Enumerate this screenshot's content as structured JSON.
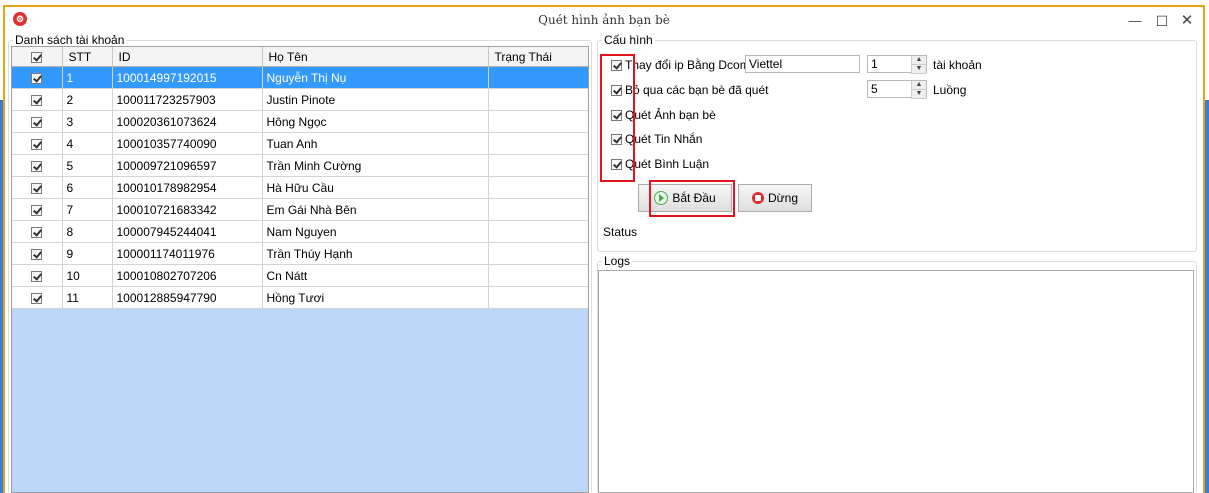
{
  "window": {
    "title": "Quét hình ảnh bạn bè",
    "app_icon": "app-logo-icon",
    "frame_color": "#e8a317"
  },
  "accounts": {
    "group_title": "Danh sách tài khoản",
    "columns": {
      "stt": "STT",
      "id": "ID",
      "name": "Họ Tên",
      "status": "Trạng Thái"
    },
    "rows": [
      {
        "stt": "1",
        "id": "100014997192015",
        "name": "Nguyễn Thị Nụ",
        "status": ""
      },
      {
        "stt": "2",
        "id": "100011723257903",
        "name": "Justin Pinote",
        "status": ""
      },
      {
        "stt": "3",
        "id": "100020361073624",
        "name": "Hông Ngọc",
        "status": ""
      },
      {
        "stt": "4",
        "id": "100010357740090",
        "name": "Tuan Anh",
        "status": ""
      },
      {
        "stt": "5",
        "id": "100009721096597",
        "name": "Trần Minh Cường",
        "status": ""
      },
      {
        "stt": "6",
        "id": "100010178982954",
        "name": "Hà Hữu Cầu",
        "status": ""
      },
      {
        "stt": "7",
        "id": "100010721683342",
        "name": "Em Gái Nhà Bên",
        "status": ""
      },
      {
        "stt": "8",
        "id": "100007945244041",
        "name": "Nam Nguyen",
        "status": ""
      },
      {
        "stt": "9",
        "id": "100001174011976",
        "name": "Trần Thúy Hạnh",
        "status": ""
      },
      {
        "stt": "10",
        "id": "100010802707206",
        "name": "Cn Nátt",
        "status": ""
      },
      {
        "stt": "11",
        "id": "100012885947790",
        "name": "Hồng Tươi",
        "status": ""
      }
    ],
    "selected_color": "#3399ff"
  },
  "config": {
    "group_title": "Cấu hình",
    "change_ip_label": "Thay đổi ip Bằng Dcom",
    "dcom_value": "Viettel",
    "accounts_count": "1",
    "accounts_unit": "tài khoản",
    "skip_scanned_label": "Bỏ qua các bạn bè đã quét",
    "threads_count": "5",
    "threads_unit": "Luồng",
    "scan_photos_label": "Quét Ảnh bạn bè",
    "scan_messages_label": "Quét Tin Nhắn",
    "scan_comments_label": "Quét Bình Luận",
    "start_button": "Bắt Đầu",
    "stop_button": "Dừng",
    "status_label": "Status",
    "highlight_color": "#e0141e"
  },
  "logs": {
    "group_title": "Logs"
  }
}
